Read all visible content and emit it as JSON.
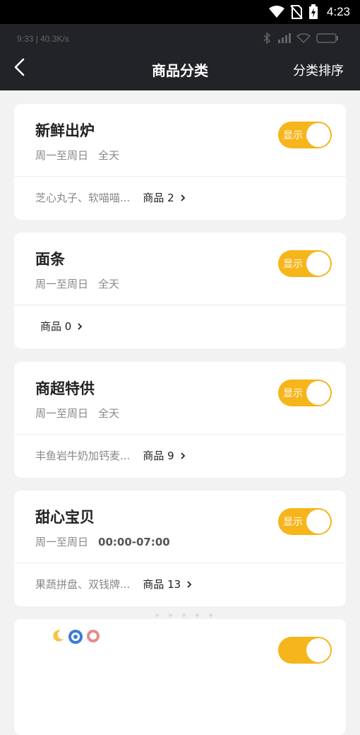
{
  "status_bar": {
    "time": "4:23"
  },
  "sub_status": {
    "left_text": "9:33 | 40.3K/s"
  },
  "header": {
    "title": "商品分类",
    "sort_label": "分类排序"
  },
  "toggle_label": "显示",
  "goods_prefix": "商品",
  "categories": [
    {
      "name": "新鲜出炉",
      "days": "周一至周日",
      "time": "全天",
      "preview": "芝心丸子、软喵喵...",
      "goods_count": "2"
    },
    {
      "name": "面条",
      "days": "周一至周日",
      "time": "全天",
      "preview": "",
      "goods_count": "0"
    },
    {
      "name": "商超特供",
      "days": "周一至周日",
      "time": "全天",
      "preview": "丰鱼岩牛奶加钙麦...",
      "goods_count": "9"
    },
    {
      "name": "甜心宝贝",
      "days": "周一至周日",
      "time": "00:00-07:00",
      "preview": "果蔬拼盘、双钱牌...",
      "goods_count": "13"
    }
  ]
}
